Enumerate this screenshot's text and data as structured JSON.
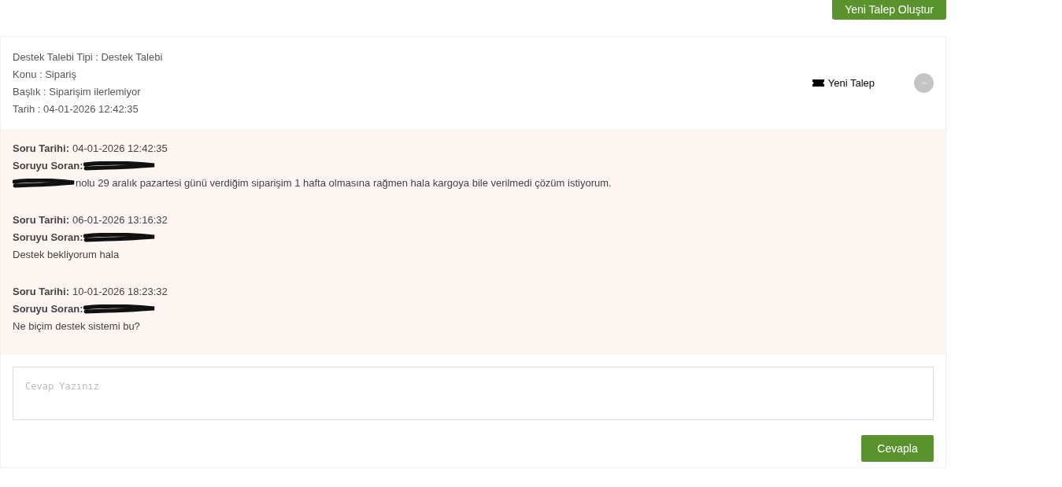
{
  "new_ticket_button": "Yeni Talep Oluştur",
  "ticket": {
    "fields": [
      "Destek Talebi Tipi : Destek Talebi",
      "Konu : Sipariş",
      "Başlık : Siparişim ilerlemiyor",
      "Tarih : 04-01-2026 12:42:35"
    ],
    "status": "Yeni Talep",
    "expanded": true
  },
  "messages": [
    {
      "date_label": "Soru Tarihi:",
      "date": "04-01-2026 12:42:35",
      "asker_label": "Soruyu Soran:",
      "body": "nolu 29 aralık pazartesi günü verdiğim siparişim 1 hafta olmasına rağmen hala kargoya bile verilmedi çözüm istiyorum.",
      "body_redacted": true
    },
    {
      "date_label": "Soru Tarihi:",
      "date": "06-01-2026 13:16:32",
      "asker_label": "Soruyu Soran:",
      "body": "Destek bekliyorum hala",
      "body_redacted": false
    },
    {
      "date_label": "Soru Tarihi:",
      "date": "10-01-2026 18:23:32",
      "asker_label": "Soruyu Soran:",
      "body": "Ne biçim destek sistemi bu?",
      "body_redacted": false
    }
  ],
  "reply": {
    "placeholder": "Cevap Yazınız",
    "button": "Cevapla"
  }
}
